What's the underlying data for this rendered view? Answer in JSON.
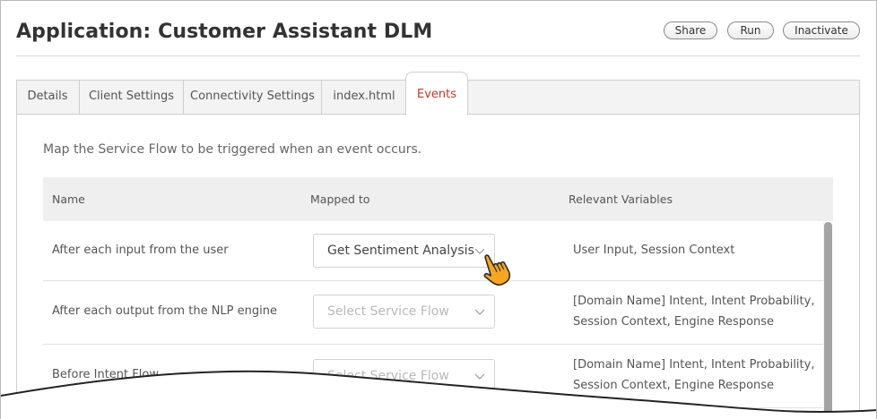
{
  "header": {
    "title": "Application: Customer Assistant DLM",
    "buttons": {
      "share": "Share",
      "run": "Run",
      "inactivate": "Inactivate"
    }
  },
  "tabs": [
    {
      "label": "Details",
      "active": false
    },
    {
      "label": "Client Settings",
      "active": false
    },
    {
      "label": "Connectivity Settings",
      "active": false
    },
    {
      "label": "index.html",
      "active": false
    },
    {
      "label": "Events",
      "active": true
    }
  ],
  "events": {
    "intro": "Map the Service Flow to be triggered when an event occurs.",
    "columns": {
      "name": "Name",
      "mapped": "Mapped to",
      "vars": "Relevant Variables"
    },
    "rows": [
      {
        "name": "After each input from the user",
        "mapped": "Get Sentiment Analysis",
        "vars": "User Input, Session Context"
      },
      {
        "name": "After each output from the NLP engine",
        "mapped": "Select Service Flow",
        "vars": "[Domain Name] Intent, Intent Probability, Session Context, Engine Response"
      },
      {
        "name": "Before Intent Flow",
        "mapped": "Select Service Flow",
        "vars": "[Domain Name] Intent, Intent Probability, Session Context, Engine Response"
      }
    ]
  },
  "colors": {
    "active_tab_text": "#c0392b",
    "cursor_fill": "#f5a623"
  },
  "icons": {
    "dropdown": "chevron-down-icon",
    "pointer": "hand-pointer-icon"
  }
}
